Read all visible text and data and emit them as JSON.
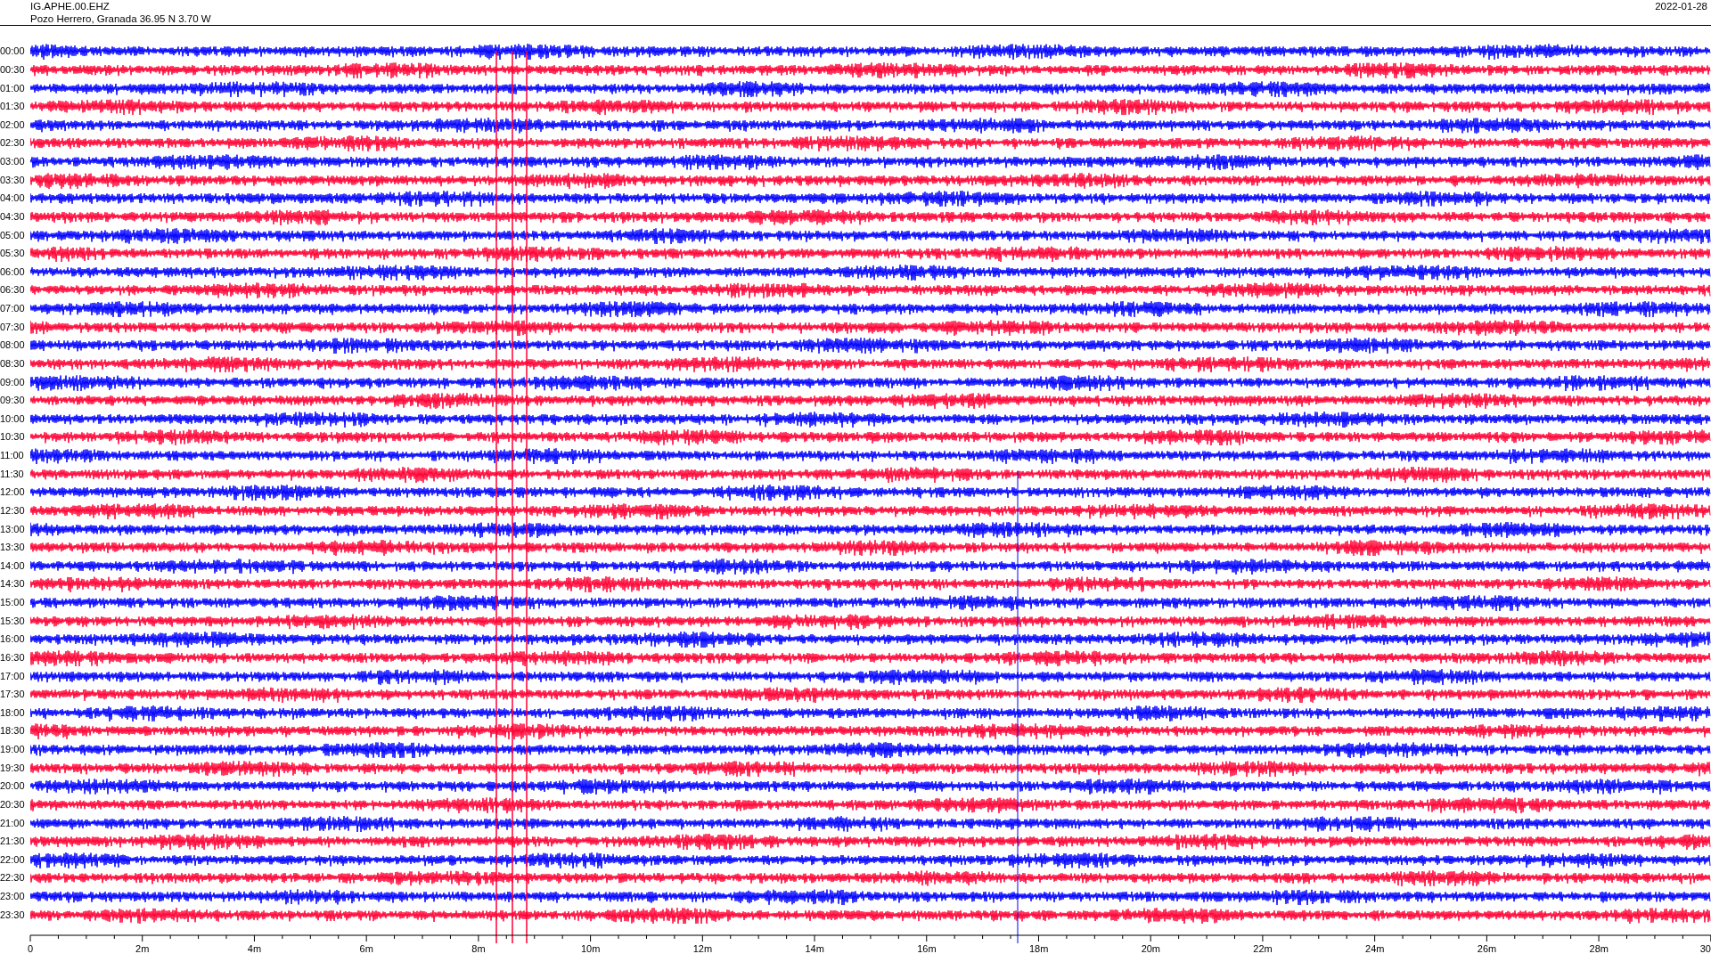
{
  "header": {
    "station": "IG.APHE.00.EHZ",
    "location": "Pozo Herrero, Granada  36.95 N 3.70 W",
    "date": "2022-01-28"
  },
  "rows": [
    {
      "time": "00:00",
      "color": "#0000ff"
    },
    {
      "time": "00:30",
      "color": "#ff0033"
    },
    {
      "time": "01:00",
      "color": "#0000ff"
    },
    {
      "time": "01:30",
      "color": "#ff0033"
    },
    {
      "time": "02:00",
      "color": "#0000ff"
    },
    {
      "time": "02:30",
      "color": "#ff0033"
    },
    {
      "time": "03:00",
      "color": "#0000ff"
    },
    {
      "time": "03:30",
      "color": "#ff0033"
    },
    {
      "time": "04:00",
      "color": "#0000ff"
    },
    {
      "time": "04:30",
      "color": "#ff0033"
    },
    {
      "time": "05:00",
      "color": "#0000ff"
    },
    {
      "time": "05:30",
      "color": "#ff0033"
    },
    {
      "time": "06:00",
      "color": "#0000ff"
    },
    {
      "time": "06:30",
      "color": "#ff0033"
    },
    {
      "time": "07:00",
      "color": "#0000ff"
    },
    {
      "time": "07:30",
      "color": "#ff0033"
    },
    {
      "time": "08:00",
      "color": "#0000ff"
    },
    {
      "time": "08:30",
      "color": "#ff0033"
    },
    {
      "time": "09:00",
      "color": "#0000ff"
    },
    {
      "time": "09:30",
      "color": "#ff0033"
    },
    {
      "time": "10:00",
      "color": "#0000ff"
    },
    {
      "time": "10:30",
      "color": "#ff0033"
    },
    {
      "time": "11:00",
      "color": "#0000ff"
    },
    {
      "time": "11:30",
      "color": "#ff0033"
    },
    {
      "time": "12:00",
      "color": "#0000ff"
    },
    {
      "time": "12:30",
      "color": "#ff0033"
    },
    {
      "time": "13:00",
      "color": "#0000ff"
    },
    {
      "time": "13:30",
      "color": "#ff0033"
    },
    {
      "time": "14:00",
      "color": "#0000ff"
    },
    {
      "time": "14:30",
      "color": "#ff0033"
    },
    {
      "time": "15:00",
      "color": "#0000ff"
    },
    {
      "time": "15:30",
      "color": "#ff0033"
    },
    {
      "time": "16:00",
      "color": "#0000ff"
    },
    {
      "time": "16:30",
      "color": "#ff0033"
    },
    {
      "time": "17:00",
      "color": "#0000ff"
    },
    {
      "time": "17:30",
      "color": "#ff0033"
    },
    {
      "time": "18:00",
      "color": "#0000ff"
    },
    {
      "time": "18:30",
      "color": "#ff0033"
    },
    {
      "time": "19:00",
      "color": "#0000ff"
    },
    {
      "time": "19:30",
      "color": "#ff0033"
    },
    {
      "time": "20:00",
      "color": "#0000ff"
    },
    {
      "time": "20:30",
      "color": "#ff0033"
    },
    {
      "time": "21:00",
      "color": "#0000ff"
    },
    {
      "time": "21:30",
      "color": "#ff0033"
    },
    {
      "time": "22:00",
      "color": "#0000ff"
    },
    {
      "time": "22:30",
      "color": "#ff0033"
    },
    {
      "time": "23:00",
      "color": "#0000ff"
    },
    {
      "time": "23:30",
      "color": "#ff0033"
    }
  ],
  "x_axis": {
    "ticks": [
      "0",
      "2m",
      "4m",
      "6m",
      "8m",
      "10m",
      "12m",
      "14m",
      "16m",
      "18m",
      "20m",
      "22m",
      "24m",
      "26m",
      "28m",
      "30"
    ]
  }
}
